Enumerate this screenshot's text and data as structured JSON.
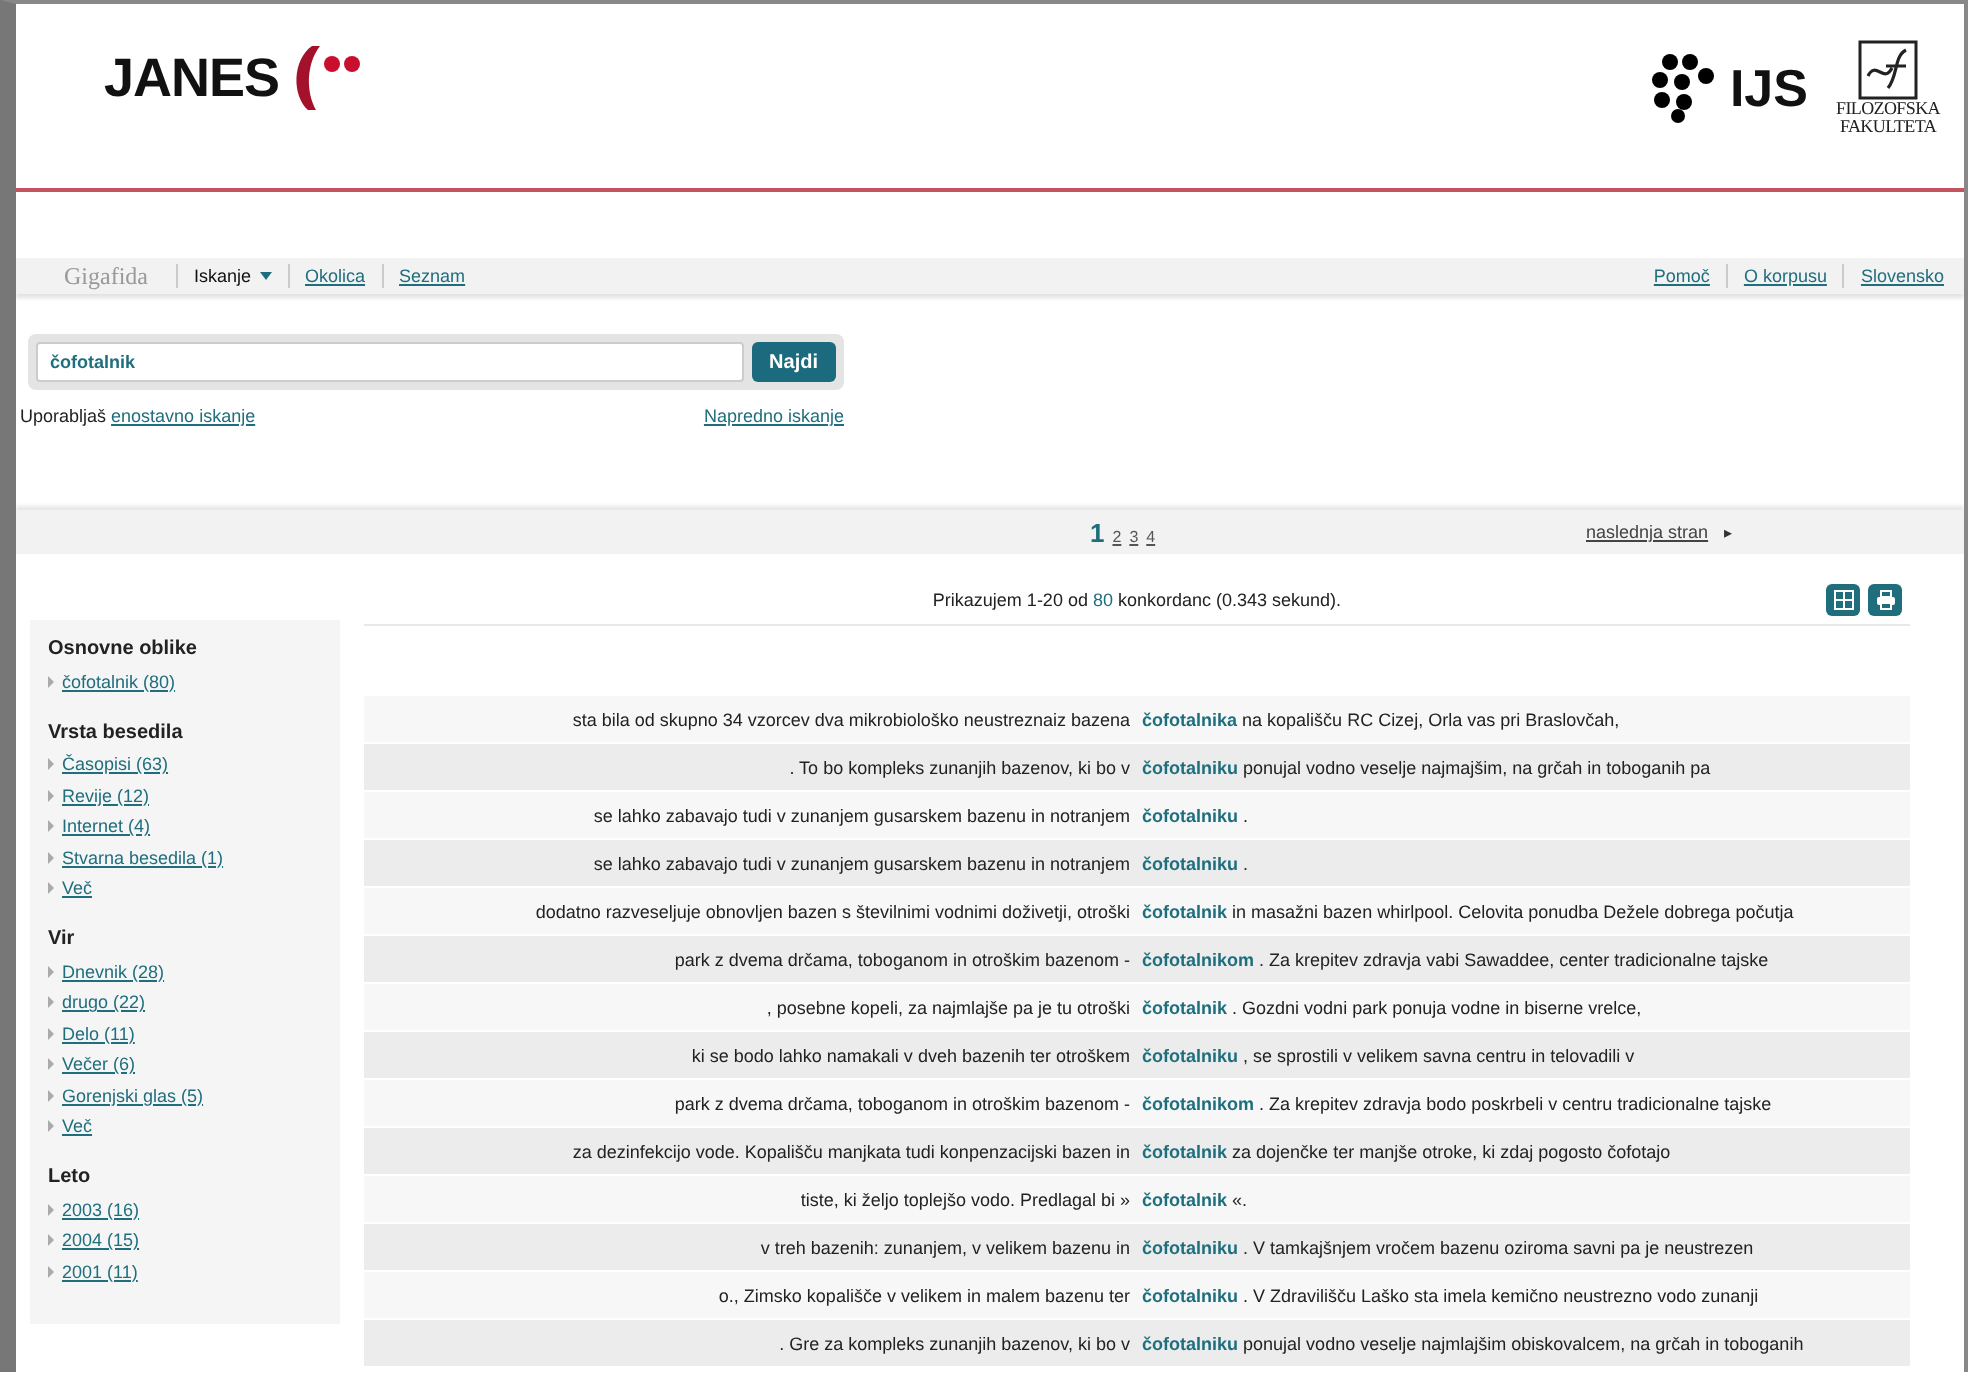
{
  "header": {
    "logo_text": "JANES",
    "partner_1": "IJS",
    "partner_2": [
      "FILOZOFSKA",
      "FAKULTETA"
    ]
  },
  "nav": {
    "brand": "Gigafida",
    "items": [
      {
        "label": "Iskanje",
        "selected": true
      },
      {
        "label": "Okolica",
        "selected": false
      },
      {
        "label": "Seznam",
        "selected": false
      }
    ],
    "right": [
      "Pomoč",
      "O korpusu",
      "Slovensko"
    ]
  },
  "search": {
    "value": "čofotalnik",
    "button": "Najdi",
    "hint": "Uporabljaš",
    "hint_link": "enostavno iskanje",
    "advanced": "Napredno iskanje"
  },
  "pagination": {
    "pages": [
      {
        "label": "1",
        "selected": true
      },
      {
        "label": "2",
        "selected": false
      },
      {
        "label": "3",
        "selected": false
      },
      {
        "label": "4",
        "selected": false
      }
    ],
    "next": "naslednja stran",
    "next_arrow": "▸"
  },
  "info": {
    "prefix": "Prikazujem 1-20 od",
    "count": "80",
    "suffix": "konkordanc (0.343 sekund)."
  },
  "sidebar": [
    {
      "title": "Osnovne oblike",
      "items": [
        "čofotalnik (80)"
      ]
    },
    {
      "title": "Vrsta besedila",
      "items": [
        "Časopisi (63)",
        "Revije (12)",
        "Internet (4)",
        "Stvarna besedila (1)",
        "Več"
      ]
    },
    {
      "title": "Vir",
      "items": [
        "Dnevnik (28)",
        "drugo (22)",
        "Delo (11)",
        "Večer (6)",
        "Gorenjski glas (5)",
        "Več"
      ]
    },
    {
      "title": "Leto",
      "items": [
        "2003 (16)",
        "2004 (15)",
        "2001 (11)"
      ]
    }
  ],
  "rows": [
    {
      "left": "sta bila od skupno 34 vzorcev dva mikrobiološko neustreznaiz bazena",
      "keyword": "čofotalnika",
      "right": "na kopališču RC Cizej, Orla vas pri Braslovčah,"
    },
    {
      "left": ". To bo kompleks zunanjih bazenov, ki bo v",
      "keyword": "čofotalniku",
      "right": "ponujal vodno veselje najmajšim, na grčah in toboganih pa"
    },
    {
      "left": "se lahko zabavajo tudi v zunanjem gusarskem bazenu in notranjem",
      "keyword": "čofotalniku",
      "right": "."
    },
    {
      "left": "se lahko zabavajo tudi v zunanjem gusarskem bazenu in notranjem",
      "keyword": "čofotalniku",
      "right": "."
    },
    {
      "left": "dodatno razveseljuje obnovljen bazen s številnimi vodnimi doživetji, otroški",
      "keyword": "čofotalnik",
      "right": "in masažni bazen whirlpool. Celovita ponudba Dežele dobrega počutja"
    },
    {
      "left": "park z dvema drčama, toboganom in otroškim bazenom -",
      "keyword": "čofotalnikom",
      "right": ". Za krepitev zdravja vabi Sawaddee, center tradicionalne tajske"
    },
    {
      "left": ", posebne kopeli, za najmlajše pa je tu otroški",
      "keyword": "čofotalnik",
      "right": ". Gozdni vodni park ponuja vodne in biserne vrelce,"
    },
    {
      "left": "ki se bodo lahko namakali v dveh bazenih ter otroškem",
      "keyword": "čofotalniku",
      "right": ", se sprostili v velikem savna centru in telovadili v"
    },
    {
      "left": "park z dvema drčama, toboganom in otroškim bazenom -",
      "keyword": "čofotalnikom",
      "right": ". Za krepitev zdravja bodo poskrbeli v centru tradicionalne tajske"
    },
    {
      "left": "za dezinfekcijo vode. Kopališču manjkata tudi konpenzacijski bazen in",
      "keyword": "čofotalnik",
      "right": "za dojenčke ter manjše otroke, ki zdaj pogosto čofotajo"
    },
    {
      "left": "tiste, ki željo toplejšo vodo. Predlagal bi »",
      "keyword": "čofotalnik",
      "right": "«."
    },
    {
      "left": "v treh bazenih: zunanjem, v velikem bazenu in",
      "keyword": "čofotalniku",
      "right": ". V tamkajšnjem vročem bazenu oziroma savni pa je neustrezen"
    },
    {
      "left": "o., Zimsko kopališče v velikem in malem bazenu ter",
      "keyword": "čofotalniku",
      "right": ". V Zdravilišču Laško sta imela kemično neustrezno vodo zunanji"
    },
    {
      "left": ". Gre za kompleks zunanjih bazenov, ki bo v",
      "keyword": "čofotalniku",
      "right": "ponujal vodno veselje najmlajšim obiskovalcem, na grčah in toboganih"
    }
  ]
}
